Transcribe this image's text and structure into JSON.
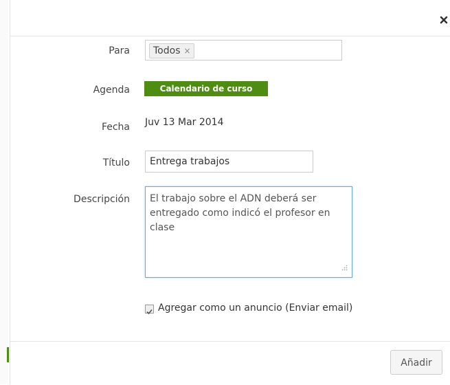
{
  "form": {
    "para": {
      "label": "Para",
      "chips": [
        {
          "label": "Todos",
          "remove_symbol": "×"
        }
      ]
    },
    "agenda": {
      "label": "Agenda",
      "value": "Calendario de curso",
      "color": "#4e8c12"
    },
    "fecha": {
      "label": "Fecha",
      "value": "Juv 13 Mar 2014"
    },
    "titulo": {
      "label": "Título",
      "value": "Entrega trabajos"
    },
    "descripcion": {
      "label": "Descripción",
      "value": "El trabajo sobre el ADN deberá ser entregado como indicó el profesor en clase"
    },
    "announce": {
      "label": "Agregar como un anuncio (Enviar email)",
      "checked": true
    }
  },
  "footer": {
    "add_label": "Añadir"
  },
  "icons": {
    "close": "close-icon",
    "check": "check-icon",
    "resize": "resize-grip-icon"
  }
}
